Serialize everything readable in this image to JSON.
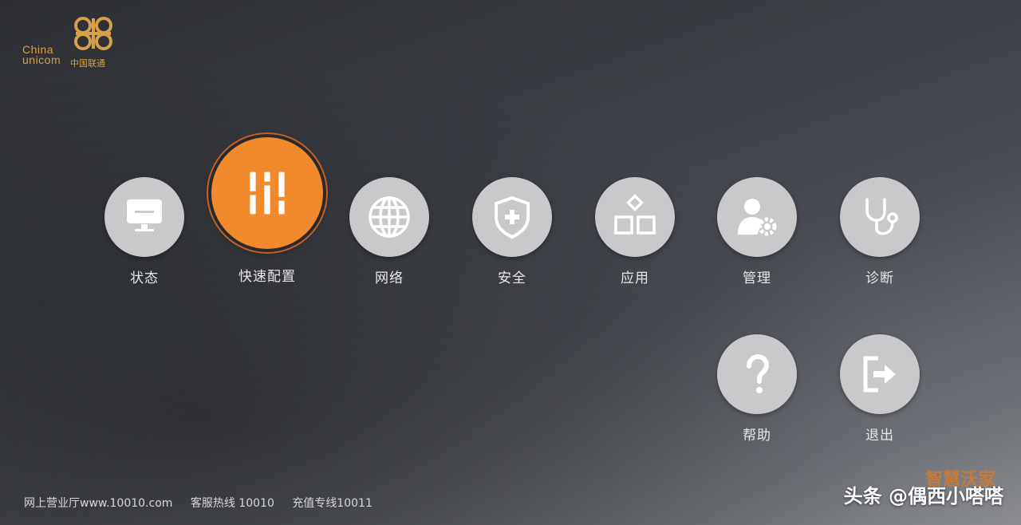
{
  "brand": {
    "logo_en": "China unicom",
    "logo_cn": "中国联通",
    "accent_color": "#f08a2c",
    "icon_color": "#c9c9cb"
  },
  "menu": [
    {
      "label": "状态",
      "icon": "monitor-icon",
      "active": false
    },
    {
      "label": "快速配置",
      "icon": "sliders-icon",
      "active": true
    },
    {
      "label": "网络",
      "icon": "globe-icon",
      "active": false
    },
    {
      "label": "安全",
      "icon": "shield-plus-icon",
      "active": false
    },
    {
      "label": "应用",
      "icon": "apps-icon",
      "active": false
    },
    {
      "label": "管理",
      "icon": "user-gear-icon",
      "active": false
    },
    {
      "label": "诊断",
      "icon": "stethoscope-icon",
      "active": false
    },
    {
      "label": "帮助",
      "icon": "question-icon",
      "active": false
    },
    {
      "label": "退出",
      "icon": "exit-icon",
      "active": false
    }
  ],
  "footer": {
    "website": "网上营业厅www.10010.com",
    "hotline": "客服热线 10010",
    "recharge": "充值专线10011"
  },
  "watermark": "头条 @偶西小嗒嗒",
  "corner_brand": "智慧沃家"
}
